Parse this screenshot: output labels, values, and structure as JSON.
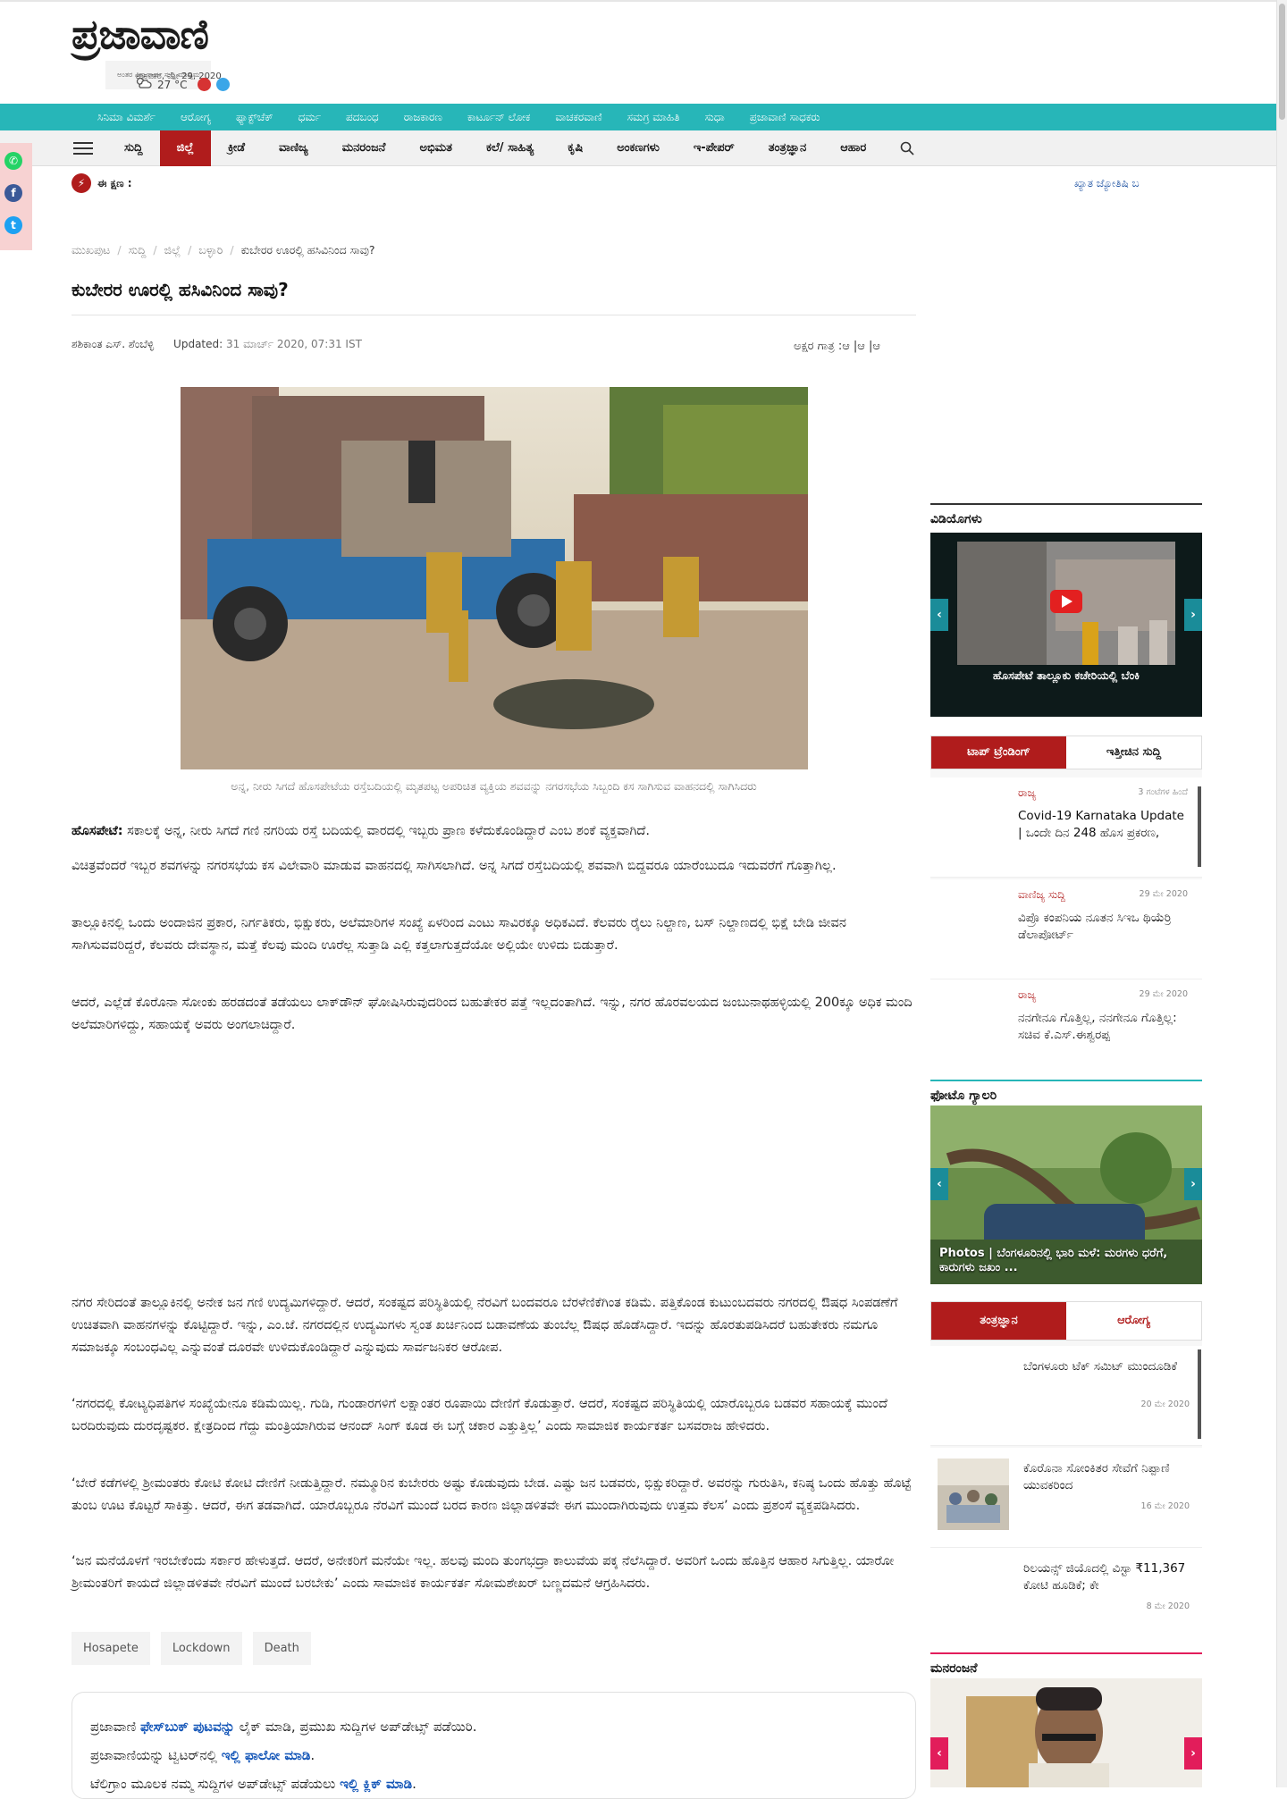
{
  "header": {
    "logo_text": "ಪ್ರಜಾವಾಣಿ",
    "tagline": "ಅಂತರ ವಿಶ್ವಾಸಾರ್ಹ ಸುದ್ದಿ ಮಾಧ್ಯಮ",
    "date": "ಶುಕ್ರವಾರ, ಮೇ 29, 2020",
    "weather": "27 °C"
  },
  "nav_top": [
    "ಸಿನಿಮಾ ವಿಮರ್ಶೆ",
    "ಆರೋಗ್ಯ",
    "ಫ್ಯಾಕ್ಟ್‌ಚೆಕ್",
    "ಧರ್ಮ",
    "ಪದಬಂಧ",
    "ರಾಜಕಾರಣ",
    "ಕಾರ್ಟೂನ್ ಲೋಕ",
    "ವಾಚಕರವಾಣಿ",
    "ಸಮಗ್ರ ಮಾಹಿತಿ",
    "ಸುಧಾ",
    "ಪ್ರಜಾವಾಣಿ ಸಾಧಕರು"
  ],
  "nav_main": [
    "ಸುದ್ದಿ",
    "ಜಿಲ್ಲೆ",
    "ಕ್ರೀಡೆ",
    "ವಾಣಿಜ್ಯ",
    "ಮನರಂಜನೆ",
    "ಅಭಿಮತ",
    "ಕಲೆ/ ಸಾಹಿತ್ಯ",
    "ಕೃಷಿ",
    "ಅಂಕಣಗಳು",
    "ಇ-ಪೇಪರ್",
    "ತಂತ್ರಜ್ಞಾನ",
    "ಆಹಾರ"
  ],
  "ticker": {
    "label": "ಈ ಕ್ಷಣ :",
    "text": "ಖ್ಯಾತ ಜ್ಯೋತಿಷಿ ಬ"
  },
  "breadcrumb": [
    "ಮುಖಪುಟ",
    "ಸುದ್ದಿ",
    "ಜಿಲ್ಲೆ",
    "ಬಳ್ಳಾರಿ",
    "ಕುಬೇರರ ಊರಲ್ಲಿ ಹಸಿವಿನಿಂದ ಸಾವು?"
  ],
  "article": {
    "title": "ಕುಬೇರರ ಊರಲ್ಲಿ ಹಸಿವಿನಿಂದ ಸಾವು?",
    "author": "ಶಶಿಕಾಂತ ಎಸ್. ಶೆಂಬೆಳ್ಳಿ",
    "updated_label": "Updated:",
    "updated_value": "31 ಮಾರ್ಚ್ 2020, 07:31 IST",
    "font_size_label": "ಅಕ್ಷರ ಗಾತ್ರ :ಆ  |ಆ  |ಆ",
    "caption": "ಅನ್ನ, ನೀರು ಸಿಗದೆ ಹೊಸಪೇಟೆಯ ರಸ್ತೆಬದಿಯಲ್ಲಿ ಮೃತಪಟ್ಟ ಅಪರಿಚಿತ ವ್ಯಕ್ತಿಯ ಶವವನ್ನು ನಗರಸಭೆಯ ಸಿಬ್ಬಂದಿ ಕಸ ಸಾಗಿಸುವ ವಾಹನದಲ್ಲಿ ಸಾಗಿಸಿದರು",
    "dateline": "ಹೊಸಪೇಟೆ:",
    "p1": " ಸಕಾಲಕ್ಕೆ ಅನ್ನ, ನೀರು ಸಿಗದೆ ಗಣಿ ನಗರಿಯ ರಸ್ತೆ ಬದಿಯಲ್ಲಿ ವಾರದಲ್ಲಿ ಇಬ್ಬರು ಪ್ರಾಣ ಕಳೆದುಕೊಂಡಿದ್ದಾರೆ ಎಂಬ ಶಂಕೆ ವ್ಯಕ್ತವಾಗಿದೆ.",
    "p2": "ವಿಚಿತ್ರವೆಂದರೆ ಇಬ್ಬರ ಶವಗಳನ್ನು ನಗರಸಭೆಯ ಕಸ ವಿಲೇವಾರಿ ಮಾಡುವ ವಾಹನದಲ್ಲಿ ಸಾಗಿಸಲಾಗಿದೆ. ಅನ್ನ ಸಿಗದೆ ರಸ್ತೆಬದಿಯಲ್ಲಿ ಶವವಾಗಿ ಬಿದ್ದವರೂ ಯಾರೆಂಬುದೂ ಇದುವರೆಗೆ ಗೊತ್ತಾಗಿಲ್ಲ.",
    "p3": "ತಾಲ್ಲೂಕಿನಲ್ಲಿ ಒಂದು ಅಂದಾಜಿನ ಪ್ರಕಾರ, ನಿರ್ಗತಿಕರು, ಭಿಕ್ಷುಕರು, ಅಲೆಮಾರಿಗಳ ಸಂಖ್ಯೆ ಏಳರಿಂದ ಎಂಟು ಸಾವಿರಕ್ಕೂ ಅಧಿಕವಿದೆ. ಕೆಲವರು ರೈಲು ನಿಲ್ದಾಣ, ಬಸ್‌ ನಿಲ್ದಾಣದಲ್ಲಿ ಭಿಕ್ಷೆ ಬೇಡಿ ಜೀವನ ಸಾಗಿಸುವವರಿದ್ದರೆ, ಕೆಲವರು ದೇವಸ್ಥಾನ, ಮತ್ತೆ ಕೆಲವು ಮಂದಿ ಊರೆಲ್ಲ ಸುತ್ತಾಡಿ ಎಲ್ಲಿ ಕತ್ತಲಾಗುತ್ತದೆಯೋ ಅಲ್ಲಿಯೇ ಉಳಿದು ಬಿಡುತ್ತಾರೆ.",
    "p4": "ಆದರೆ, ಎಲ್ಲೆಡೆ ಕೊರೊನಾ ಸೋಂಕು ಹರಡದಂತೆ ತಡೆಯಲು ಲಾಕ್‌ಡೌನ್‌ ಘೋಷಿಸಿರುವುದರಿಂದ ಬಹುತೇಕರ ಪತ್ತೆ ಇಲ್ಲದಂತಾಗಿದೆ. ಇನ್ನು, ನಗರ ಹೊರವಲಯದ ಜಂಬುನಾಥಹಳ್ಳಿಯಲ್ಲಿ 200ಕ್ಕೂ ಅಧಿಕ ಮಂದಿ ಅಲೆಮಾರಿಗಳಿದ್ದು, ಸಹಾಯಕ್ಕೆ ಅವರು ಅಂಗಲಾಚಿದ್ದಾರೆ.",
    "p5": "ನಗರ ಸೇರಿದಂತೆ ತಾಲ್ಲೂಕಿನಲ್ಲಿ ಅನೇಕ ಜನ ಗಣಿ ಉದ್ಯಮಿಗಳಿದ್ದಾರೆ. ಆದರೆ, ಸಂಕಷ್ಟದ ಪರಿಸ್ಥಿತಿಯಲ್ಲಿ ನೆರವಿಗೆ ಬಂದವರೂ ಬೆರಳೆಣಿಕೆಗಿಂತ ಕಡಿಮೆ. ಪತ್ತಿಕೊಂಡ ಕುಟುಂಬದವರು ನಗರದಲ್ಲಿ ಔಷಧ ಸಿಂಪಡಣೆಗೆ ಉಚಿತವಾಗಿ ವಾಹನಗಳನ್ನು ಕೊಟ್ಟಿದ್ದಾರೆ. ಇನ್ನು, ಎಂ.ಜೆ. ನಗರದಲ್ಲಿನ ಉದ್ಯಮಿಗಳು ಸ್ವಂತ ಖರ್ಚಿನಿಂದ ಬಡಾವಣೆಯ ತುಂಬೆಲ್ಲ ಔಷಧ ಹೊಡೆಸಿದ್ದಾರೆ. ಇದನ್ನು ಹೊರತುಪಡಿಸಿದರೆ ಬಹುತೇಕರು ನಮಗೂ ಸಮಾಜಕ್ಕೂ ಸಂಬಂಧವಿಲ್ಲ ಎನ್ನುವಂತೆ ದೂರವೇ ಉಳಿದುಕೊಂಡಿದ್ದಾರೆ ಎನ್ನುವುದು ಸಾರ್ವಜನಿಕರ ಆರೋಪ.",
    "p6": "‘ನಗರದಲ್ಲಿ ಕೋಟ್ಯಧಿಪತಿಗಳ ಸಂಖ್ಯೆಯೇನೂ ಕಡಿಮೆಯಿಲ್ಲ. ಗುಡಿ, ಗುಂಡಾರಗಳಿಗೆ ಲಕ್ಷಾಂತರ ರೂಪಾಯಿ ದೇಣಿಗೆ ಕೊಡುತ್ತಾರೆ. ಆದರೆ, ಸಂಕಷ್ಟದ ಪರಿಸ್ಥಿತಿಯಲ್ಲಿ ಯಾರೊಬ್ಬರೂ ಬಡವರ ಸಹಾಯಕ್ಕೆ ಮುಂದೆ ಬರದಿರುವುದು ದುರದೃಷ್ಟಕರ. ಕ್ಷೇತ್ರದಿಂದ ಗೆದ್ದು ಮಂತ್ರಿಯಾಗಿರುವ ಆನಂದ್‌ ಸಿಂಗ್‌ ಕೂಡ ಈ ಬಗ್ಗೆ ಚಕಾರ ಎತ್ತುತ್ತಿಲ್ಲ’ ಎಂದು ಸಾಮಾಜಿಕ ಕಾರ್ಯಕರ್ತ ಬಸವರಾಜ ಹೇಳಿದರು.",
    "p7": "‘ಬೇರೆ ಕಡೆಗಳಲ್ಲಿ ಶ್ರೀಮಂತರು ಕೋಟಿ ಕೋಟಿ ದೇಣಿಗೆ ನೀಡುತ್ತಿದ್ದಾರೆ. ನಮ್ಮೂರಿನ ಕುಬೇರರು ಅಷ್ಟು ಕೊಡುವುದು ಬೇಡ. ಎಷ್ಟು ಜನ ಬಡವರು, ಭಿಕ್ಷುಕರಿದ್ದಾರೆ. ಅವರನ್ನು ಗುರುತಿಸಿ, ಕನಿಷ್ಠ ಒಂದು ಹೊತ್ತು ಹೊಟ್ಟೆ ತುಂಬ ಊಟ ಕೊಟ್ಟರೆ ಸಾಕಿತ್ತು. ಆದರೆ, ಈಗ ತಡವಾಗಿದೆ. ಯಾರೊಬ್ಬರೂ ನೆರವಿಗೆ ಮುಂದೆ ಬರದ ಕಾರಣ ಜಿಲ್ಲಾಡಳಿತವೇ ಈಗ ಮುಂದಾಗಿರುವುದು ಉತ್ತಮ ಕೆಲಸ’ ಎಂದು ಪ್ರಶಂಸೆ ವ್ಯಕ್ತಪಡಿಸಿದರು.",
    "p8": "‘ಜನ ಮನೆಯೊಳಗೆ ಇರಬೇಕೆಂದು ಸರ್ಕಾರ ಹೇಳುತ್ತದೆ. ಆದರೆ, ಅನೇಕರಿಗೆ ಮನೆಯೇ ಇಲ್ಲ. ಹಲವು ಮಂದಿ ತುಂಗಭದ್ರಾ ಕಾಲುವೆಯ ಪಕ್ಕ ನೆಲೆಸಿದ್ದಾರೆ. ಅವರಿಗೆ ಒಂದು ಹೊತ್ತಿನ ಆಹಾರ ಸಿಗುತ್ತಿಲ್ಲ. ಯಾರೋ ಶ್ರೀಮಂತರಿಗೆ ಕಾಯದೆ ಜಿಲ್ಲಾಡಳಿತವೇ ನೆರವಿಗೆ ಮುಂದೆ ಬರಬೇಕು’ ಎಂದು ಸಾಮಾಜಿಕ ಕಾರ್ಯಕರ್ತ ಸೋಮಶೇಖರ್‌ ಬಣ್ಣದಮನೆ ಆಗ್ರಹಿಸಿದರು.",
    "tags": [
      "Hosapete",
      "Lockdown",
      "Death"
    ]
  },
  "follow": {
    "l1a": "ಪ್ರಜಾವಾಣಿ ",
    "l1b": "ಫೇಸ್‌ಬುಕ್ ಪುಟವನ್ನು",
    "l1c": " ಲೈಕ್ ಮಾಡಿ, ಪ್ರಮುಖ ಸುದ್ದಿಗಳ ಅಪ್‌ಡೇಟ್ಸ್ ಪಡೆಯಿರಿ.",
    "l2a": "ಪ್ರಜಾವಾಣಿಯನ್ನು ಟ್ವಿಟರ್‌ನಲ್ಲಿ ",
    "l2b": "ಇಲ್ಲಿ ಫಾಲೋ ಮಾಡಿ",
    "l2c": ".",
    "l3a": "ಟೆಲಿಗ್ರಾಂ ಮೂಲಕ ನಮ್ಮ ಸುದ್ದಿಗಳ ಅಪ್‌ಡೇಟ್ಸ್ ಪಡೆಯಲು ",
    "l3b": "ಇಲ್ಲಿ ಕ್ಲಿಕ್ ಮಾಡಿ",
    "l3c": "."
  },
  "sidebar": {
    "videos_title": "ವಿಡಿಯೊಗಳು",
    "video_caption": "ಹೊಸಪೇಟೆ ತಾಲ್ಲೂಕು ಕಚೇರಿಯಲ್ಲಿ ಬೆಂಕಿ",
    "tab_trending": "ಟಾಪ್ ಟ್ರೆಂಡಿಂಗ್",
    "tab_recent": "ಇತ್ತೀಚಿನ ಸುದ್ದಿ",
    "trending": [
      {
        "cat": "ರಾಜ್ಯ",
        "date": "3 ಗಂಟೆಗಳ ಹಿಂದೆ",
        "text": "Covid-19 Karnataka Update | ಒಂದೇ ದಿನ 248 ಹೊಸ ಪ್ರಕರಣ,"
      },
      {
        "cat": "ವಾಣಿಜ್ಯ ಸುದ್ದಿ",
        "date": "29 ಮೇ 2020",
        "text": "ವಿಪ್ರೊ ಕಂಪನಿಯ ನೂತನ ಸಿಇಒ ಥಿಯೆರ್ರಿ ಡೆಲಾಪೋರ್ಟ್‌"
      },
      {
        "cat": "ರಾಜ್ಯ",
        "date": "29 ಮೇ 2020",
        "text": "ನನಗೇನೂ ಗೊತ್ತಿಲ್ಲ, ನನಗೇನೂ ಗೊತ್ತಿಲ್ಲ: ಸಚಿವ ಕೆ.ಎಸ್.ಈಶ್ವರಪ್ಪ"
      }
    ],
    "gallery_title": "ಫೋಟೊ ಗ್ಯಾಲರಿ",
    "gallery_caption": "Photos | ಬೆಂಗಳೂರಿನಲ್ಲಿ ಭಾರಿ ಮಳೆ: ಮರಗಳು ಧರೆಗೆ, ಕಾರುಗಳು ಜಖಂ ...",
    "tab_tech": "ತಂತ್ರಜ್ಞಾನ",
    "tab_health": "ಆರೋಗ್ಯ",
    "tech": [
      {
        "text": "ಬೆಂಗಳೂರು ಟೆಕ್ ಸಮಿಟ್ ಮುಂದೂಡಿಕೆ",
        "date": "20 ಮೇ 2020"
      },
      {
        "text": "ಕೊರೊನಾ ಸೋಂಕಿತರ ಸೇವೆಗೆ ನಿಪ್ಪಾಣಿ ಯುವಕರಿಂದ",
        "date": "16 ಮೇ 2020"
      },
      {
        "text": "ರಿಲಯನ್ಸ್ ಜಿಯೊದಲ್ಲಿ ವಿಸ್ಟಾ ₹11,367 ಕೋಟಿ ಹೂಡಿಕೆ; ಕೇ",
        "date": "8 ಮೇ 2020"
      }
    ],
    "ent_title": "ಮನರಂಜನೆ"
  },
  "colors": {
    "teal": "#27b6b8",
    "red": "#b01c1c",
    "link": "#1456b8"
  }
}
